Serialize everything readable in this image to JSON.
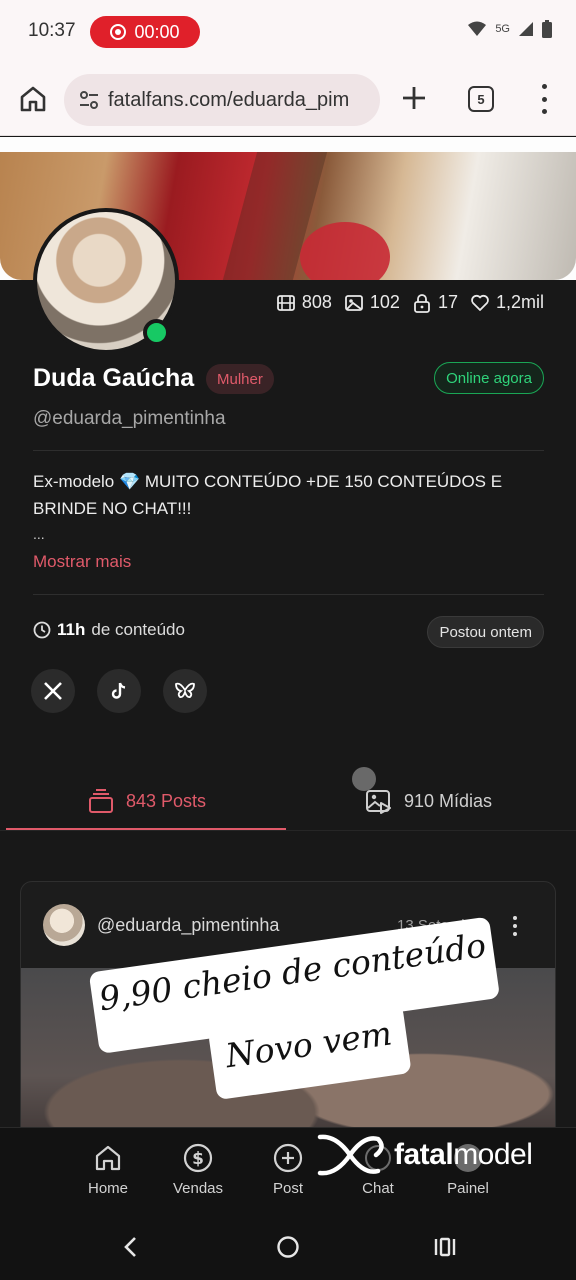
{
  "status_bar": {
    "time": "10:37",
    "recording": "00:00",
    "network": "5G"
  },
  "browser": {
    "url": "fatalfans.com/eduarda_pim",
    "tab_count": "5"
  },
  "profile": {
    "stats": [
      {
        "icon": "video-icon",
        "value": "808"
      },
      {
        "icon": "image-icon",
        "value": "102"
      },
      {
        "icon": "lock-icon",
        "value": "17"
      },
      {
        "icon": "heart-icon",
        "value": "1,2mil"
      }
    ],
    "name": "Duda Gaúcha",
    "gender": "Mulher",
    "online": "Online agora",
    "handle": "@eduarda_pimentinha",
    "bio": "Ex-modelo 💎 MUITO CONTEÚDO +DE 150 CONTEÚDOS E BRINDE NO CHAT!!!",
    "bio_ellipsis": "...",
    "show_more": "Mostrar mais",
    "content_hours": "11h",
    "content_suffix": "de conteúdo",
    "posted": "Postou ontem",
    "socials": [
      "x-icon",
      "tiktok-icon",
      "bluesky-icon"
    ]
  },
  "tabs": {
    "posts": "843 Posts",
    "media": "910 Mídias"
  },
  "post": {
    "handle": "@eduarda_pimentinha",
    "date": "13 Setembro"
  },
  "overlay": {
    "line1": "9,90 cheio de conteúdo",
    "line2": "Novo vem"
  },
  "bottom_nav": [
    {
      "icon": "home-icon",
      "label": "Home"
    },
    {
      "icon": "dollar-icon",
      "label": "Vendas"
    },
    {
      "icon": "plus-circle-icon",
      "label": "Post"
    },
    {
      "icon": "chat-icon",
      "label": "Chat"
    },
    {
      "icon": "panel-icon",
      "label": "Painel"
    }
  ],
  "watermark": {
    "brand_bold": "fatal",
    "brand_rest": "model"
  },
  "colors": {
    "accent": "#e05a6a",
    "online": "#17c964",
    "background": "#181818"
  }
}
